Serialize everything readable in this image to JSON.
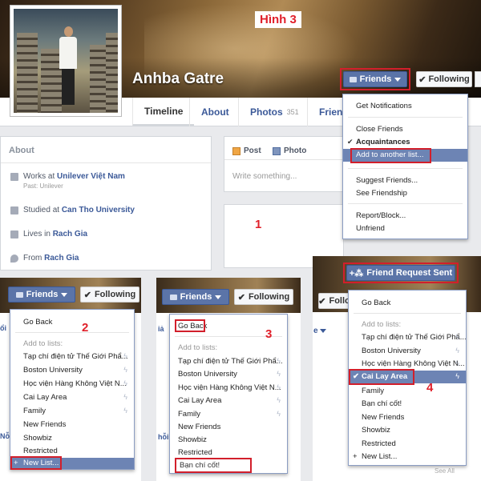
{
  "header": {
    "name": "Anhba Gatre",
    "badge": "Hình 3",
    "friends_btn": "Friends",
    "following_btn": "Following"
  },
  "tabs": [
    {
      "label": "Timeline"
    },
    {
      "label": "About"
    },
    {
      "label": "Photos",
      "count": "351"
    },
    {
      "label": "Frien"
    }
  ],
  "about": {
    "title": "About",
    "items": [
      {
        "prefix": "Works at ",
        "link": "Unilever Việt Nam",
        "sub": "Past: Unilever"
      },
      {
        "prefix": "Studied at ",
        "link": "Can Tho University"
      },
      {
        "prefix": "Lives in ",
        "link": "Rach Gia"
      },
      {
        "prefix": "From ",
        "link": "Rach Gia"
      }
    ]
  },
  "composer": {
    "post_tab": "Post",
    "photo_tab": "Photo",
    "placeholder": "Write something..."
  },
  "step_numbers": [
    "1",
    "2",
    "3",
    "4"
  ],
  "menu1": {
    "items": [
      "Get Notifications",
      "Close Friends",
      "Acquaintances",
      "Add to another list...",
      "Suggest Friends...",
      "See Friendship",
      "Report/Block...",
      "Unfriend"
    ]
  },
  "menu2": {
    "items": [
      "Go Back",
      "Add to lists:",
      "Tạp chí điện tử Thế Giới Phẩ...",
      "Boston University",
      "Học viện Hàng Không Việt N...",
      "Cai Lay Area",
      "Family",
      "New Friends",
      "Showbiz",
      "Restricted",
      "New List..."
    ]
  },
  "menu3": {
    "items": [
      "Go Back",
      "Add to lists:",
      "Tạp chí điện tử Thế Giới Phẩ...",
      "Boston University",
      "Học viện Hàng Không Việt N...",
      "Cai Lay Area",
      "Family",
      "New Friends",
      "Showbiz",
      "Restricted"
    ],
    "new_list_value": "Bạn chí cốt!"
  },
  "panel4": {
    "request_btn": "Friend Request Sent",
    "partial_following": "Follo",
    "side_word": "e",
    "items": [
      "Go Back",
      "Add to lists:",
      "Tạp chí điện tử Thế Giới Phẩ...",
      "Boston University",
      "Học viện Hàng Không Việt N...",
      "Cai Lay Area",
      "Family",
      "Bạn chí cốt!",
      "New Friends",
      "Showbiz",
      "Restricted",
      "New List..."
    ],
    "see_all": "See All"
  },
  "edge_fragments": [
    "ổi",
    "iả",
    "Nỗi",
    "hỗi"
  ],
  "colors": {
    "fb_blue": "#3b5998",
    "button_blue": "#5b74a8",
    "highlight": "#6d84b4",
    "annotation_red": "#e0202a"
  }
}
